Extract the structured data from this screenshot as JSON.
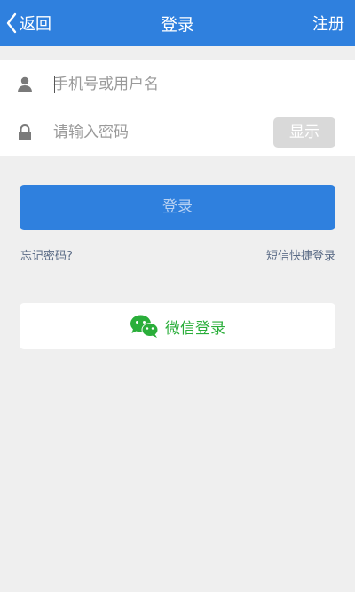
{
  "header": {
    "back_label": "返回",
    "title": "登录",
    "register_label": "注册"
  },
  "form": {
    "username_placeholder": "手机号或用户名",
    "password_placeholder": "请输入密码",
    "show_password_label": "显示"
  },
  "actions": {
    "login_label": "登录",
    "forgot_password_label": "忘记密码?",
    "sms_login_label": "短信快捷登录",
    "wechat_login_label": "微信登录"
  },
  "icons": {
    "back": "chevron-left-icon",
    "user": "user-icon",
    "lock": "lock-icon",
    "wechat": "wechat-icon"
  },
  "colors": {
    "primary": "#2f80de",
    "wechat_green": "#2aae3a",
    "background": "#efefef"
  }
}
